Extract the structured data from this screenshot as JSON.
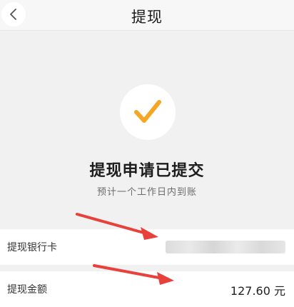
{
  "header": {
    "title": "提现",
    "back_icon": "chevron-left-icon"
  },
  "status": {
    "icon": "checkmark-icon",
    "icon_color": "#f5a623",
    "title": "提现申请已提交",
    "subtitle": "预计一个工作日内到账"
  },
  "details": {
    "bank_card_label": "提现银行卡",
    "amount_label": "提现金额",
    "amount_value": "127.60 元"
  },
  "annotations": {
    "arrow_color": "#e8403a"
  }
}
